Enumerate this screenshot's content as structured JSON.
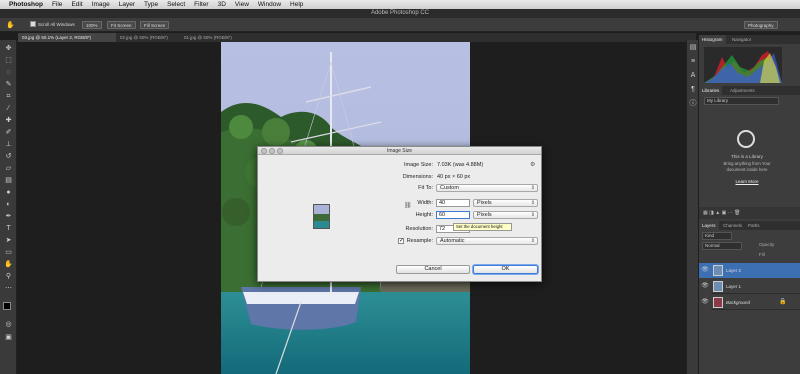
{
  "menubar": {
    "app": "Photoshop",
    "items": [
      "File",
      "Edit",
      "Image",
      "Layer",
      "Type",
      "Select",
      "Filter",
      "3D",
      "View",
      "Window",
      "Help"
    ]
  },
  "window_title": "Adobe Photoshop CC",
  "options_bar": {
    "scroll_all": "Scroll All Windows",
    "zoom_100": "100%",
    "fit_screen": "Fit Screen",
    "fill_screen": "Fill Screen",
    "workspace": "Photography"
  },
  "doc_tabs": [
    "03.jpg @ 50.1% (Layer 2, RGB/8*)",
    "02.jpg @ 50% (RGB/8*)",
    "01.jpg @ 50% (RGB/8*)"
  ],
  "panels": {
    "histogram_tabs": [
      "Histogram",
      "Navigator"
    ],
    "libraries_tabs": [
      "Libraries",
      "Adjustments"
    ],
    "library_select": "My Library",
    "library_empty": "This is a Library",
    "library_hint": "Bring anything from Your document inside here",
    "learn_more": "Learn More",
    "layers_tabs": [
      "Layers",
      "Channels",
      "Paths"
    ],
    "kind": "Kind",
    "blend_mode": "Normal",
    "opacity_label": "Opacity",
    "fill_label": "Fill",
    "layers": [
      "Layer 2",
      "Layer 1",
      "Background"
    ]
  },
  "dialog": {
    "title": "Image Size",
    "image_size_label": "Image Size:",
    "image_size_value": "7.03K (was 4.88M)",
    "dimensions_label": "Dimensions:",
    "dimensions_value": "40 px  ×  60 px",
    "fit_to_label": "Fit To:",
    "fit_to_value": "Custom",
    "width_label": "Width:",
    "width_value": "40",
    "width_unit": "Pixels",
    "height_label": "Height:",
    "height_value": "60",
    "height_unit": "Pixels",
    "resolution_label": "Resolution:",
    "resolution_value": "72",
    "resample_label": "Resample:",
    "resample_value": "Automatic",
    "cancel": "Cancel",
    "ok": "OK",
    "tooltip": "Set the document height"
  },
  "colors": {
    "accent": "#3d6fb3",
    "bg": "#1e1e1e",
    "panel": "#3d3d3d"
  }
}
